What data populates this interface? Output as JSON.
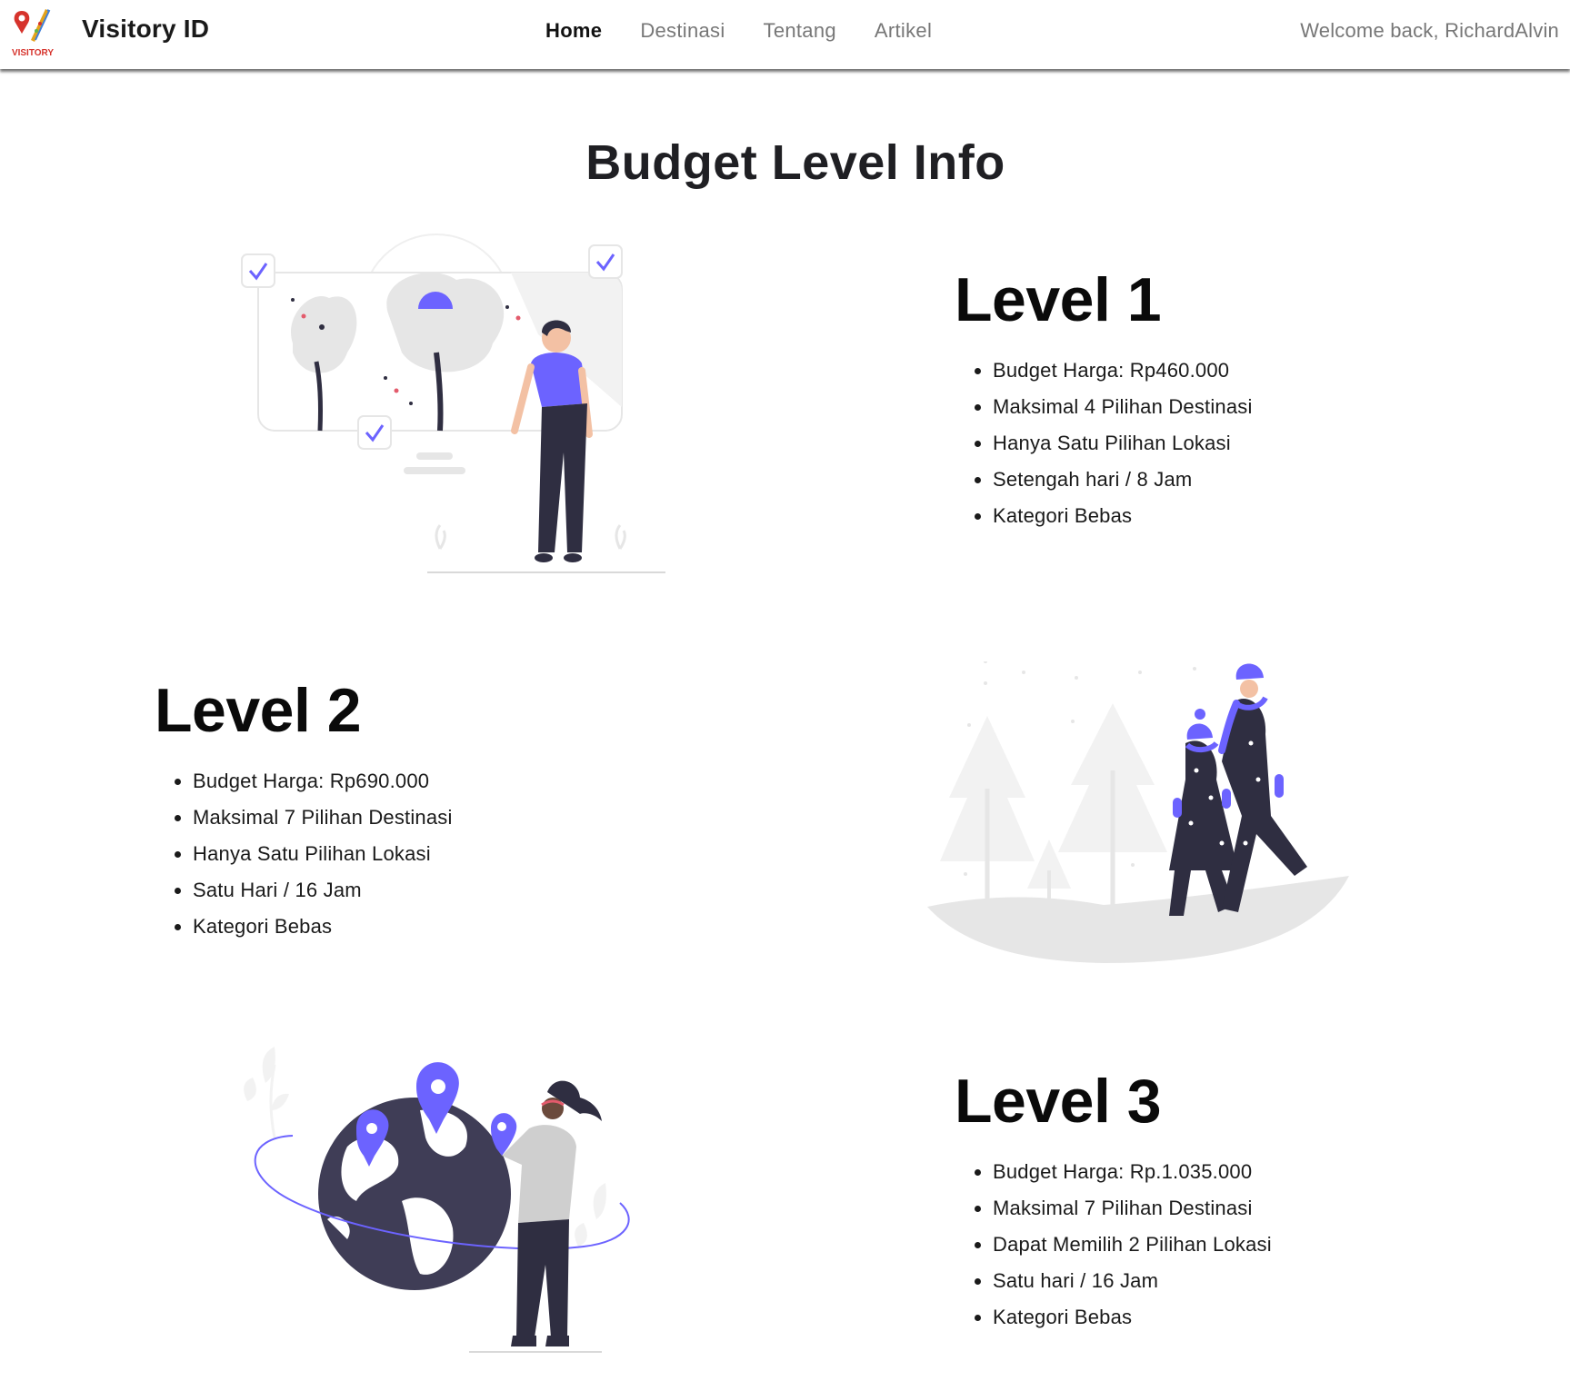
{
  "nav": {
    "logo_text": "VISITORY",
    "brand": "Visitory ID",
    "links": [
      {
        "label": "Home",
        "active": true
      },
      {
        "label": "Destinasi",
        "active": false
      },
      {
        "label": "Tentang",
        "active": false
      },
      {
        "label": "Artikel",
        "active": false
      }
    ],
    "welcome": "Welcome back, RichardAlvin"
  },
  "page": {
    "title": "Budget Level Info"
  },
  "levels": [
    {
      "heading": "Level 1",
      "items": [
        "Budget Harga: Rp460.000",
        "Maksimal 4 Pilihan Destinasi",
        "Hanya Satu Pilihan Lokasi",
        "Setengah hari / 8 Jam",
        "Kategori Bebas"
      ]
    },
    {
      "heading": "Level 2",
      "items": [
        "Budget Harga: Rp690.000",
        "Maksimal 7 Pilihan Destinasi",
        "Hanya Satu Pilihan Lokasi",
        "Satu Hari / 16 Jam",
        "Kategori Bebas"
      ]
    },
    {
      "heading": "Level 3",
      "items": [
        "Budget Harga: Rp.1.035.000",
        "Maksimal 7 Pilihan Destinasi",
        "Dapat Memilih 2 Pilihan Lokasi",
        "Satu hari / 16 Jam",
        "Kategori Bebas"
      ]
    }
  ],
  "theme": {
    "accent": "#6c63ff",
    "dark": "#2f2e41",
    "light_gray": "#f2f2f2",
    "logo_red": "#d6332c"
  }
}
